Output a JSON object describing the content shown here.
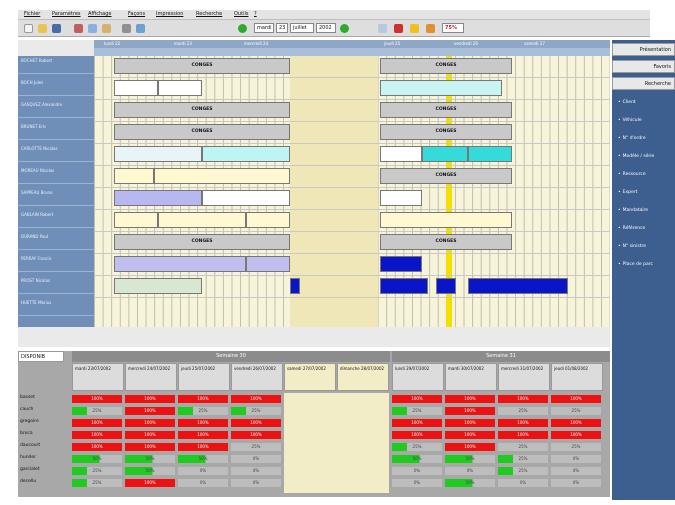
{
  "menu": [
    "Fichier",
    "Paramètres",
    "Affichage",
    "Façons",
    "Impression",
    "Recherche",
    "Outils",
    "?"
  ],
  "toolbar": {
    "date_day": "mardi",
    "date_num": "23",
    "date_month": "juillet",
    "date_year": "2002",
    "zoom": "75%"
  },
  "planning": {
    "day_labels": [
      "lundi 22",
      "mardi 23",
      "mercredi 24",
      "jeudi 25",
      "vendredi 26",
      "samedi 27",
      "dimanche 28"
    ],
    "employees": [
      "BOCHET Robert",
      "BOCH Jules",
      "GASQUEZ Alexandre",
      "BRUNET Eric",
      "CARLOTTE Nicolas",
      "MOREAU Nicolas",
      "SAPPEAU Bruno",
      "GABLAIN Robert",
      "DURAND Paul",
      "PERRAY Francis",
      "PROST Nicolas",
      "HUETTE Marius"
    ],
    "conges_label": "CONGES"
  },
  "right_panel": {
    "buttons": [
      "Présentation",
      "Favoris",
      "Recherche"
    ],
    "items": [
      "Client",
      "Véhicule",
      "N° d'ordre",
      "Modèle / série",
      "Ressource",
      "Expert",
      "Mandataire",
      "Référence",
      "N° sinistre",
      "Place de parc"
    ]
  },
  "dispo": {
    "title": "DISPONIB",
    "weeks": [
      "Semaine 30",
      "Semaine 31"
    ],
    "days": [
      "mardi 23/07/2002",
      "mercredi 24/07/2002",
      "jeudi 25/07/2002",
      "vendredi 26/07/2002",
      "samedi 27/07/2002",
      "dimanche 28/07/2002",
      "lundi 29/07/2002",
      "mardi 30/07/2002",
      "mercredi 31/07/2002",
      "jeudi 01/08/2002"
    ],
    "people": [
      "basset",
      "cauch",
      "gregoire",
      "broca",
      "daucourt",
      "hunder",
      "garcialet",
      "decellu"
    ],
    "cells": [
      [
        "100%",
        "100%",
        "100%",
        "100%",
        "100%",
        "100%",
        "100%",
        "100%"
      ],
      [
        "25%",
        "100%",
        "25%",
        "25%",
        "25%",
        "100%",
        "25%",
        "25%"
      ],
      [
        "100%",
        "100%",
        "100%",
        "100%",
        "100%",
        "100%",
        "100%",
        "100%"
      ],
      [
        "100%",
        "100%",
        "100%",
        "100%",
        "100%",
        "100%",
        "100%",
        "100%"
      ],
      [
        "100%",
        "100%",
        "100%",
        "25%",
        "25%",
        "100%",
        "25%",
        "25%"
      ],
      [
        "50%",
        "50%",
        "50%",
        "0%",
        "50%",
        "50%",
        "25%",
        "0%"
      ],
      [
        "25%",
        "50%",
        "0%",
        "0%",
        "0%",
        "0%",
        "25%",
        "0%"
      ],
      [
        "25%",
        "100%",
        "0%",
        "0%",
        "0%",
        "50%",
        "0%",
        "0%"
      ]
    ]
  }
}
